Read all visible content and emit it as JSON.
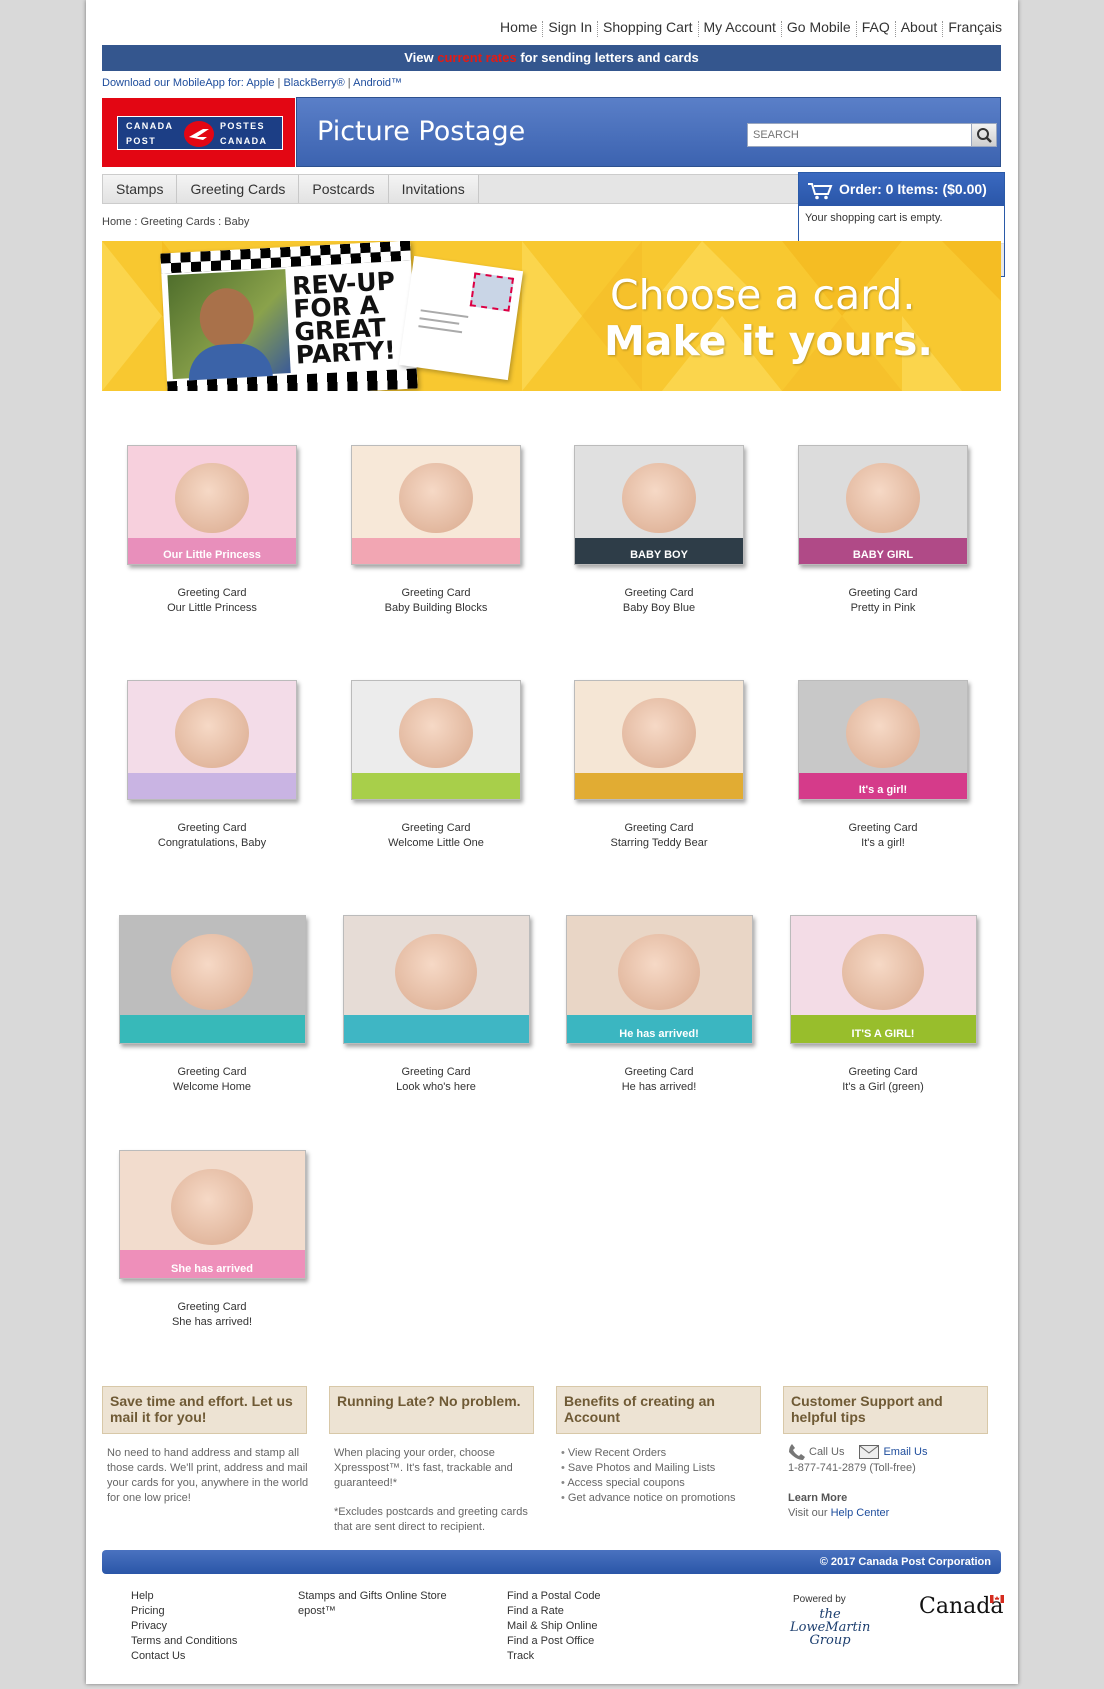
{
  "topnav": [
    "Home",
    "Sign In",
    "Shopping Cart",
    "My Account",
    "Go Mobile",
    "FAQ",
    "About",
    "Français"
  ],
  "ratebar": {
    "pre": "View ",
    "link": "current rates",
    "post": " for sending letters and cards"
  },
  "appline": {
    "pre": "Download our MobileApp for: ",
    "apple": "Apple",
    "blackberry": "BlackBerry®",
    "android": "Android™"
  },
  "logo": {
    "canada": "CANADA",
    "postes": "POSTES",
    "post": "POST",
    "canada2": "CANADA"
  },
  "header": {
    "title": "Picture Postage",
    "search_placeholder": "SEARCH"
  },
  "cattabs": [
    "Stamps",
    "Greeting Cards",
    "Postcards",
    "Invitations"
  ],
  "cart": {
    "title": "Order: 0 Items: ($0.00)",
    "empty": "Your shopping cart is empty."
  },
  "breadcrumb": "Home : Greeting Cards : Baby",
  "banner": {
    "card_text": "REV-UP FOR A GREAT PARTY!",
    "line1": "Choose a card.",
    "line2": "Make it yours."
  },
  "products": [
    {
      "type": "Greeting Card",
      "name": "Our Little Princess",
      "caption": "Our Little Princess",
      "frame": "#e88fbb",
      "bg": "#f7d0dd"
    },
    {
      "type": "Greeting Card",
      "name": "Baby Building Blocks",
      "caption": "",
      "frame": "#f2a6b3",
      "bg": "#f7e8d8"
    },
    {
      "type": "Greeting Card",
      "name": "Baby Boy Blue",
      "caption": "BABY BOY",
      "frame": "#2e3d48",
      "bg": "#e0e0e0"
    },
    {
      "type": "Greeting Card",
      "name": "Pretty in Pink",
      "caption": "BABY GIRL",
      "frame": "#b04a87",
      "bg": "#dcdcdc"
    },
    {
      "type": "Greeting Card",
      "name": "Congratulations, Baby",
      "caption": "",
      "frame": "#c9b4e3",
      "bg": "#f3dce8"
    },
    {
      "type": "Greeting Card",
      "name": "Welcome Little One",
      "caption": "",
      "frame": "#a8cf4a",
      "bg": "#ececec"
    },
    {
      "type": "Greeting Card",
      "name": "Starring Teddy Bear",
      "caption": "",
      "frame": "#e1ac33",
      "bg": "#f5e6d5"
    },
    {
      "type": "Greeting Card",
      "name": "It's a girl!",
      "caption": "It's a girl!",
      "frame": "#d53b8a",
      "bg": "#c8c8c8"
    },
    {
      "type": "Greeting Card",
      "name": "Welcome Home",
      "caption": "",
      "frame": "#37b9b9",
      "bg": "#bdbdbd"
    },
    {
      "type": "Greeting Card",
      "name": "Look who's here",
      "caption": "",
      "frame": "#3fb6c4",
      "bg": "#e6dcd6"
    },
    {
      "type": "Greeting Card",
      "name": "He has arrived!",
      "caption": "He has arrived!",
      "frame": "#3bb6c1",
      "bg": "#e9d6c6"
    },
    {
      "type": "Greeting Card",
      "name": "It's a Girl (green)",
      "caption": "IT'S A GIRL!",
      "frame": "#98be2c",
      "bg": "#f3dce6"
    },
    {
      "type": "Greeting Card",
      "name": "She has arrived!",
      "caption": "She has arrived",
      "frame": "#ee8fba",
      "bg": "#f2dccd"
    }
  ],
  "info": [
    {
      "title": "Save time and effort. Let us mail it for you!",
      "text": "No need to hand address and stamp all those cards. We'll print, address and mail your cards for you, anywhere in the world for one low price!"
    },
    {
      "title": "Running Late? No problem.",
      "text": "When placing your order, choose Xpresspost™. It's fast, trackable and guaranteed!*",
      "note": "*Excludes postcards and greeting cards that are sent direct to recipient."
    },
    {
      "title": "Benefits of creating an Account",
      "items": [
        "View Recent Orders",
        "Save Photos and Mailing Lists",
        "Access special coupons",
        "Get advance notice on promotions"
      ]
    },
    {
      "title": "Customer Support and helpful tips",
      "call": "Call Us",
      "email": "Email Us",
      "phone": "1-877-741-2879 (Toll-free)",
      "learn": "Learn More",
      "visit": "Visit our ",
      "help": "Help Center"
    }
  ],
  "copyright": "© 2017 Canada Post Corporation",
  "footer": {
    "col1": [
      "Help",
      "Pricing",
      "Privacy",
      "Terms and Conditions",
      "Contact Us"
    ],
    "col2": [
      "Stamps and Gifts Online Store",
      "epost™"
    ],
    "col3": [
      "Find a Postal Code",
      "Find a Rate",
      "Mail & Ship Online",
      "Find a Post Office",
      "Track"
    ],
    "powered": "Powered by",
    "lowemartin": "the LoweMartin Group",
    "canada": "Canada"
  }
}
